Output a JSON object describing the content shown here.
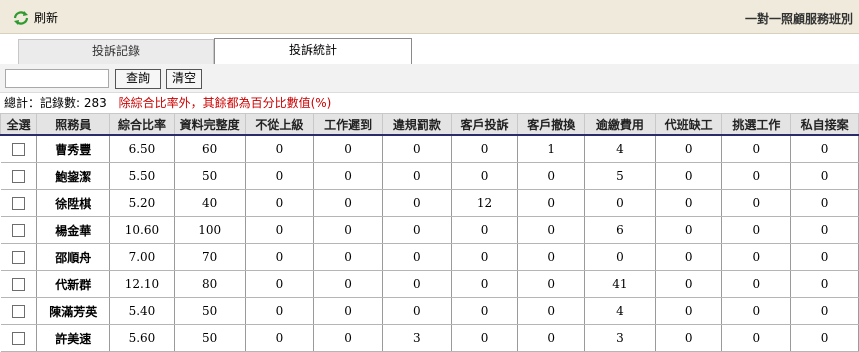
{
  "toolbar": {
    "refresh_label": "刷新",
    "page_title": "一對一照顧服務班別"
  },
  "tabs": [
    {
      "label": "投訴記錄"
    },
    {
      "label": "投訴統計"
    }
  ],
  "search": {
    "value": "",
    "placeholder": "",
    "query_label": "查詢",
    "clear_label": "清空"
  },
  "summary": {
    "count_text": "總計：記錄數: 283",
    "note": "除綜合比率外，其餘都為百分比數值(%)"
  },
  "table": {
    "headers": [
      "全選",
      "照務員",
      "綜合比率",
      "資料完整度",
      "不從上級",
      "工作遲到",
      "違規罰款",
      "客戶投訴",
      "客戶撤換",
      "逾繳費用",
      "代班缺工",
      "挑選工作",
      "私自接案"
    ],
    "rows": [
      {
        "name": "曹秀豐",
        "values": [
          "6.50",
          "60",
          "0",
          "0",
          "0",
          "0",
          "1",
          "4",
          "0",
          "0",
          "0"
        ]
      },
      {
        "name": "鮑鋆潔",
        "values": [
          "5.50",
          "50",
          "0",
          "0",
          "0",
          "0",
          "0",
          "5",
          "0",
          "0",
          "0"
        ]
      },
      {
        "name": "徐陞棋",
        "values": [
          "5.20",
          "40",
          "0",
          "0",
          "0",
          "12",
          "0",
          "0",
          "0",
          "0",
          "0"
        ]
      },
      {
        "name": "楊金華",
        "values": [
          "10.60",
          "100",
          "0",
          "0",
          "0",
          "0",
          "0",
          "6",
          "0",
          "0",
          "0"
        ]
      },
      {
        "name": "邵順舟",
        "values": [
          "7.00",
          "70",
          "0",
          "0",
          "0",
          "0",
          "0",
          "0",
          "0",
          "0",
          "0"
        ]
      },
      {
        "name": "代新群",
        "values": [
          "12.10",
          "80",
          "0",
          "0",
          "0",
          "0",
          "0",
          "41",
          "0",
          "0",
          "0"
        ]
      },
      {
        "name": "陳滿芳英",
        "values": [
          "5.40",
          "50",
          "0",
          "0",
          "0",
          "0",
          "0",
          "4",
          "0",
          "0",
          "0"
        ]
      },
      {
        "name": "許美速",
        "values": [
          "5.60",
          "50",
          "0",
          "0",
          "3",
          "0",
          "0",
          "3",
          "0",
          "0",
          "0"
        ]
      }
    ]
  },
  "colors": {
    "header_bg": "#efeadb",
    "note_red": "#cc0000",
    "header_underline": "#2b2b6b"
  }
}
